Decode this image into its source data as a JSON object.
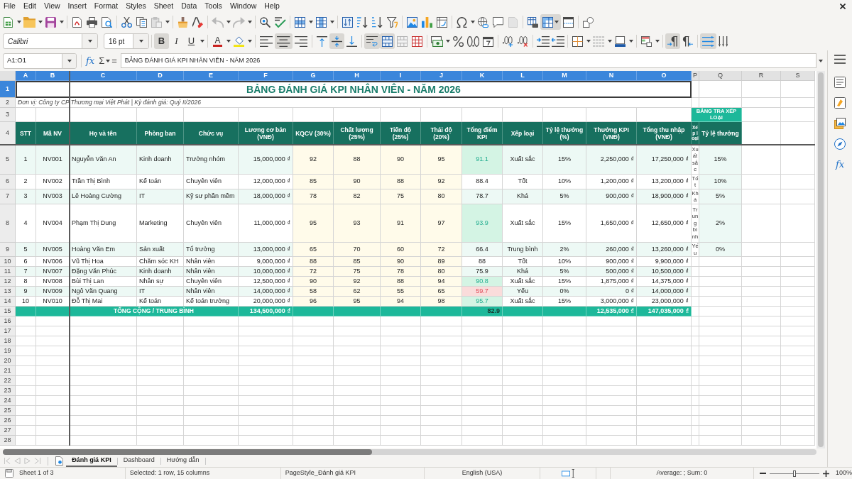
{
  "menu_bar": {
    "items": [
      "File",
      "Edit",
      "View",
      "Insert",
      "Format",
      "Styles",
      "Sheet",
      "Data",
      "Tools",
      "Window",
      "Help"
    ]
  },
  "standard_toolbar": {
    "freeze_rows_columns": true
  },
  "formatting_toolbar": {
    "font_name": "Calibri",
    "font_size": "16 pt",
    "bold": {
      "label": "B",
      "on": true
    },
    "italic": {
      "label": "I",
      "on": false
    },
    "underline": {
      "label": "U",
      "on": false
    },
    "font_color": {
      "label": "A"
    },
    "align_left": false,
    "align_center": true,
    "align_right": false,
    "align_top": false,
    "align_middle": true,
    "align_bottom": false,
    "wrap_text": true,
    "merge_and_center": true,
    "left_to_right": true,
    "right_to_left": false,
    "text_horizontal": true,
    "text_vertical": false
  },
  "formula_bar": {
    "name_box": "A1:O1",
    "function_wizard": "fx",
    "sum": "Σ",
    "equals": "=",
    "content": "BẢNG ĐÁNH GIÁ KPI NHÂN VIÊN - NĂM 2026"
  },
  "sheet": {
    "columns": [
      {
        "label": "A",
        "selected": true
      },
      {
        "label": "B",
        "selected": true
      },
      {
        "label": "C",
        "selected": true
      },
      {
        "label": "D",
        "selected": true
      },
      {
        "label": "E",
        "selected": true
      },
      {
        "label": "F",
        "selected": true
      },
      {
        "label": "G",
        "selected": true
      },
      {
        "label": "H",
        "selected": true
      },
      {
        "label": "I",
        "selected": true
      },
      {
        "label": "J",
        "selected": true
      },
      {
        "label": "K",
        "selected": true
      },
      {
        "label": "L",
        "selected": true
      },
      {
        "label": "M",
        "selected": true
      },
      {
        "label": "N",
        "selected": true
      },
      {
        "label": "O",
        "selected": true
      },
      {
        "label": "P",
        "selected": false
      },
      {
        "label": "Q",
        "selected": false
      },
      {
        "label": "R",
        "selected": false
      },
      {
        "label": "S",
        "selected": false
      }
    ],
    "row_numbers": [
      {
        "label": "1",
        "selected": true
      },
      {
        "label": "2",
        "selected": false
      },
      {
        "label": "3",
        "selected": false
      },
      {
        "label": "4",
        "selected": false
      },
      {
        "label": "5",
        "selected": false
      },
      {
        "label": "6",
        "selected": false
      },
      {
        "label": "7",
        "selected": false
      },
      {
        "label": "8",
        "selected": false
      },
      {
        "label": "9",
        "selected": false
      },
      {
        "label": "10",
        "selected": false
      },
      {
        "label": "11",
        "selected": false
      },
      {
        "label": "12",
        "selected": false
      },
      {
        "label": "13",
        "selected": false
      },
      {
        "label": "14",
        "selected": false
      },
      {
        "label": "15",
        "selected": false
      },
      {
        "label": "16",
        "selected": false
      },
      {
        "label": "17",
        "selected": false
      },
      {
        "label": "18",
        "selected": false
      },
      {
        "label": "19",
        "selected": false
      },
      {
        "label": "20",
        "selected": false
      },
      {
        "label": "21",
        "selected": false
      },
      {
        "label": "22",
        "selected": false
      },
      {
        "label": "23",
        "selected": false
      },
      {
        "label": "24",
        "selected": false
      },
      {
        "label": "25",
        "selected": false
      },
      {
        "label": "26",
        "selected": false
      },
      {
        "label": "27",
        "selected": false
      },
      {
        "label": "28",
        "selected": false
      }
    ],
    "title": "BẢNG ĐÁNH GIÁ KPI NHÂN VIÊN - NĂM 2026",
    "subtitle": "Đơn vị: Công ty CP Thương mại Việt Phát | Kỳ đánh giá: Quý II/2026",
    "lookup_title": "BẢNG TRA XẾP LOẠI",
    "headers": [
      "STT",
      "Mã NV",
      "Họ và tên",
      "Phòng ban",
      "Chức vụ",
      "Lương cơ bản (VNĐ)",
      "KQCV (30%)",
      "Chất lượng (25%)",
      "Tiến độ (25%)",
      "Thái độ (20%)",
      "Tổng điểm KPI",
      "Xếp loại",
      "Tỷ lệ thưởng (%)",
      "Thưởng KPI (VNĐ)",
      "Tổng thu nhập (VNĐ)"
    ],
    "lookup_headers": [
      "Xếp loại",
      "Tỷ lệ thưởng"
    ],
    "records": [
      {
        "shaded": true,
        "high_score": true,
        "low_score": false,
        "cells": [
          "1",
          "NV001",
          "Nguyễn Văn An",
          "Kinh doanh",
          "Trưởng nhóm",
          "15,000,000 ₫",
          "92",
          "88",
          "90",
          "95",
          "91.1",
          "Xuất sắc",
          "15%",
          "2,250,000 ₫",
          "17,250,000 ₫"
        ]
      },
      {
        "shaded": false,
        "high_score": false,
        "low_score": false,
        "cells": [
          "2",
          "NV002",
          "Trần Thị Bình",
          "Kế toán",
          "Chuyên viên",
          "12,000,000 ₫",
          "85",
          "90",
          "88",
          "92",
          "88.4",
          "Tốt",
          "10%",
          "1,200,000 ₫",
          "13,200,000 ₫"
        ]
      },
      {
        "shaded": true,
        "high_score": false,
        "low_score": false,
        "cells": [
          "3",
          "NV003",
          "Lê Hoàng Cường",
          "IT",
          "Kỹ sư phần mềm",
          "18,000,000 ₫",
          "78",
          "82",
          "75",
          "80",
          "78.7",
          "Khá",
          "5%",
          "900,000 ₫",
          "18,900,000 ₫"
        ]
      },
      {
        "shaded": false,
        "high_score": true,
        "low_score": false,
        "cells": [
          "4",
          "NV004",
          "Phạm Thị Dung",
          "Marketing",
          "Chuyên viên",
          "11,000,000 ₫",
          "95",
          "93",
          "91",
          "97",
          "93.9",
          "Xuất sắc",
          "15%",
          "1,650,000 ₫",
          "12,650,000 ₫"
        ]
      },
      {
        "shaded": true,
        "high_score": false,
        "low_score": false,
        "cells": [
          "5",
          "NV005",
          "Hoàng Văn Em",
          "Sản xuất",
          "Tổ trưởng",
          "13,000,000 ₫",
          "65",
          "70",
          "60",
          "72",
          "66.4",
          "Trung bình",
          "2%",
          "260,000 ₫",
          "13,260,000 ₫"
        ]
      },
      {
        "shaded": false,
        "high_score": false,
        "low_score": false,
        "cells": [
          "6",
          "NV006",
          "Vũ Thị Hoa",
          "Chăm sóc KH",
          "Nhân viên",
          "9,000,000 ₫",
          "88",
          "85",
          "90",
          "89",
          "88",
          "Tốt",
          "10%",
          "900,000 ₫",
          "9,900,000 ₫"
        ]
      },
      {
        "shaded": true,
        "high_score": false,
        "low_score": false,
        "cells": [
          "7",
          "NV007",
          "Đặng Văn Phúc",
          "Kinh doanh",
          "Nhân viên",
          "10,000,000 ₫",
          "72",
          "75",
          "78",
          "80",
          "75.9",
          "Khá",
          "5%",
          "500,000 ₫",
          "10,500,000 ₫"
        ]
      },
      {
        "shaded": false,
        "high_score": true,
        "low_score": false,
        "cells": [
          "8",
          "NV008",
          "Bùi Thị Lan",
          "Nhân sự",
          "Chuyên viên",
          "12,500,000 ₫",
          "90",
          "92",
          "88",
          "94",
          "90.8",
          "Xuất sắc",
          "15%",
          "1,875,000 ₫",
          "14,375,000 ₫"
        ]
      },
      {
        "shaded": true,
        "high_score": false,
        "low_score": true,
        "cells": [
          "9",
          "NV009",
          "Ngô Văn Quang",
          "IT",
          "Nhân viên",
          "14,000,000 ₫",
          "58",
          "62",
          "55",
          "65",
          "59.7",
          "Yếu",
          "0%",
          "0 ₫",
          "14,000,000 ₫"
        ]
      },
      {
        "shaded": false,
        "high_score": true,
        "low_score": false,
        "cells": [
          "10",
          "NV010",
          "Đỗ Thị Mai",
          "Kế toán",
          "Kế toán trưởng",
          "20,000,000 ₫",
          "96",
          "95",
          "94",
          "98",
          "95.7",
          "Xuất sắc",
          "15%",
          "3,000,000 ₫",
          "23,000,000 ₫"
        ]
      }
    ],
    "lookup_rows": [
      {
        "grade": "Xuất sắc",
        "rate": "15%"
      },
      {
        "grade": "Tốt",
        "rate": "10%"
      },
      {
        "grade": "Khá",
        "rate": "5%"
      },
      {
        "grade": "Trung bình",
        "rate": "2%"
      },
      {
        "grade": "Yếu",
        "rate": "0%"
      }
    ],
    "total": {
      "label": "TỔNG CỘNG / TRUNG BÌNH",
      "base_salary": "134,500,000 ₫",
      "kpi_average": "82.9",
      "bonus": "12,535,000 ₫",
      "total_income": "147,035,000 ₫"
    }
  },
  "sheet_tabs": [
    {
      "label": "Đánh giá KPI",
      "selected": true
    },
    {
      "label": "Dashboard",
      "selected": false
    },
    {
      "label": "Hướng dẫn",
      "selected": false
    }
  ],
  "sidebar": {
    "functions": "fx"
  },
  "status_bar": {
    "sheet": "Sheet 1 of 3",
    "selection": "Selected: 1 row, 15 columns",
    "page_style": "PageStyle_Đánh giá KPI",
    "language": "English (USA)",
    "summary": "Average: ; Sum: 0",
    "zoom": {
      "label": "100%",
      "level": 0.5
    }
  }
}
